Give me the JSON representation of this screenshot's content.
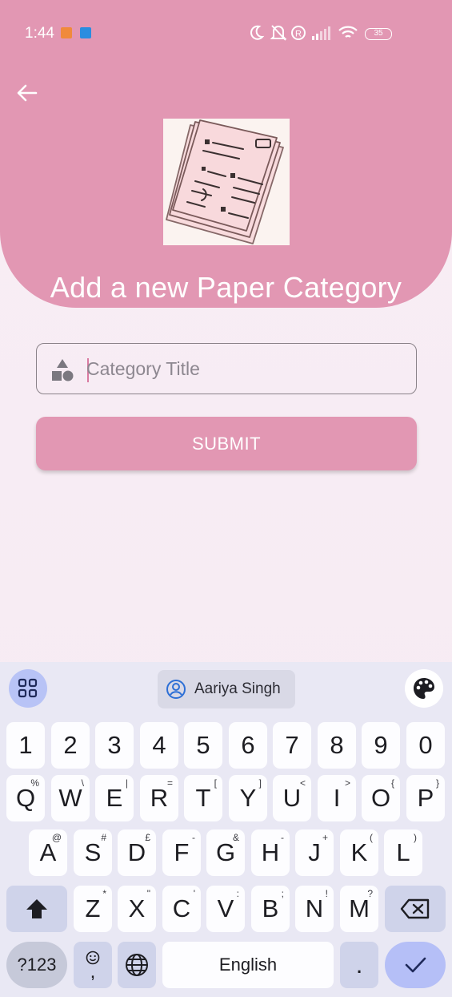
{
  "status_bar": {
    "time": "1:44",
    "battery": "35"
  },
  "header": {
    "title": "Add a new Paper Category"
  },
  "form": {
    "category_placeholder": "Category Title",
    "category_value": "",
    "submit_label": "SUBMIT"
  },
  "keyboard": {
    "suggestion_name": "Aariya Singh",
    "row_numbers": [
      "1",
      "2",
      "3",
      "4",
      "5",
      "6",
      "7",
      "8",
      "9",
      "0"
    ],
    "row_q": [
      {
        "key": "Q",
        "hint": "%"
      },
      {
        "key": "W",
        "hint": "\\"
      },
      {
        "key": "E",
        "hint": "|"
      },
      {
        "key": "R",
        "hint": "="
      },
      {
        "key": "T",
        "hint": "["
      },
      {
        "key": "Y",
        "hint": "]"
      },
      {
        "key": "U",
        "hint": "<"
      },
      {
        "key": "I",
        "hint": ">"
      },
      {
        "key": "O",
        "hint": "{"
      },
      {
        "key": "P",
        "hint": "}"
      }
    ],
    "row_a": [
      {
        "key": "A",
        "hint": "@"
      },
      {
        "key": "S",
        "hint": "#"
      },
      {
        "key": "D",
        "hint": "£"
      },
      {
        "key": "F",
        "hint": "-"
      },
      {
        "key": "G",
        "hint": "&"
      },
      {
        "key": "H",
        "hint": "-"
      },
      {
        "key": "J",
        "hint": "+"
      },
      {
        "key": "K",
        "hint": "("
      },
      {
        "key": "L",
        "hint": ")"
      }
    ],
    "row_z": [
      {
        "key": "Z",
        "hint": "*"
      },
      {
        "key": "X",
        "hint": "\""
      },
      {
        "key": "C",
        "hint": "'"
      },
      {
        "key": "V",
        "hint": ":"
      },
      {
        "key": "B",
        "hint": ";"
      },
      {
        "key": "N",
        "hint": "!"
      },
      {
        "key": "M",
        "hint": "?"
      }
    ],
    "symbols_label": "?123",
    "comma_label": ",",
    "space_label": "English",
    "period_label": "."
  },
  "colors": {
    "accent": "#e297b3",
    "background": "#f8ecf3",
    "keyboard_bg": "#e9e8f4",
    "enter_key": "#b5bff7"
  }
}
